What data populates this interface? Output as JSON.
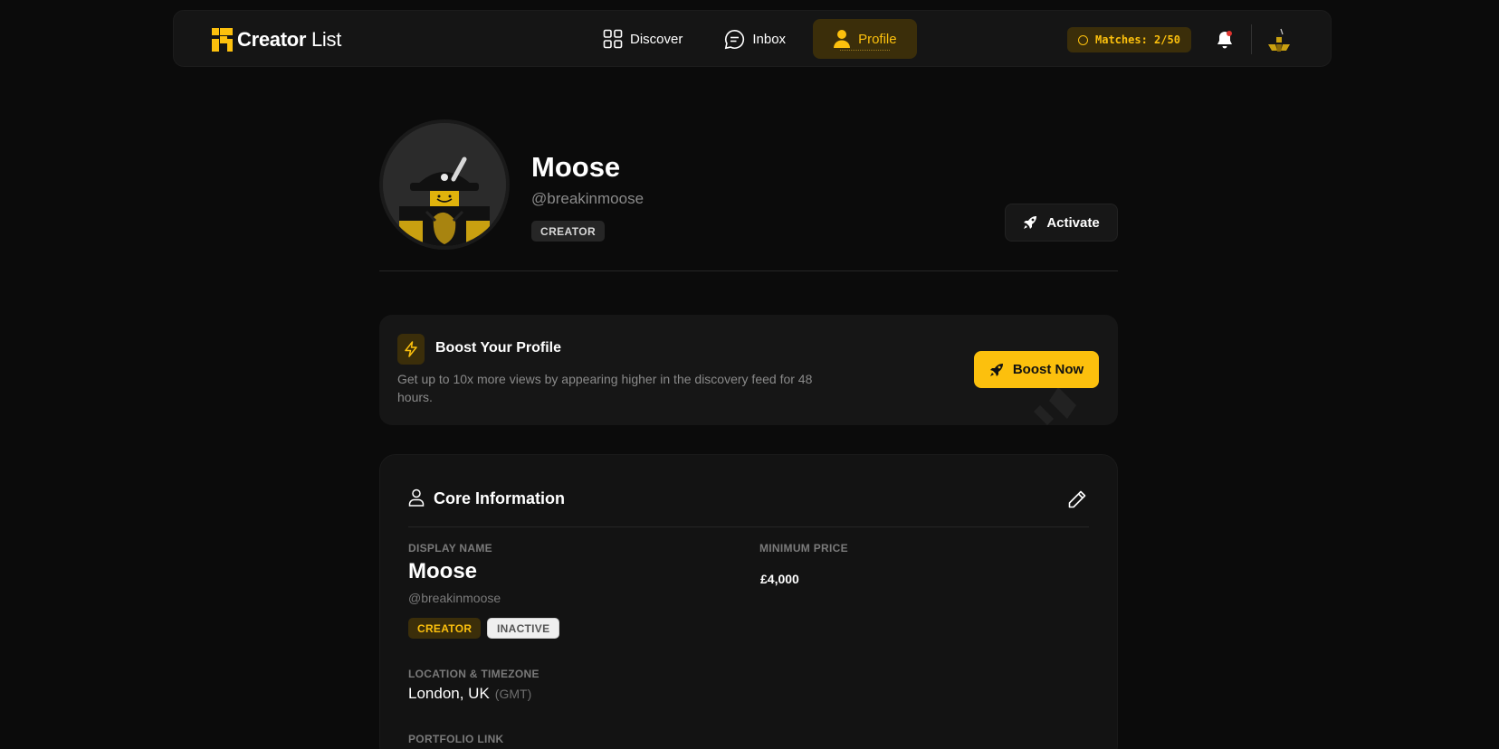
{
  "brand": {
    "name_bold": "Creator",
    "name_light": " List",
    "accent": "#fcc00d"
  },
  "nav": {
    "items": [
      {
        "label": "Discover",
        "icon": "grid-icon"
      },
      {
        "label": "Inbox",
        "icon": "chat-icon"
      },
      {
        "label": "Profile",
        "icon": "user-icon",
        "active": true
      }
    ],
    "matches": "Matches: 2/50"
  },
  "profile": {
    "name": "Moose",
    "handle": "@breakinmoose",
    "role_badge": "CREATOR",
    "activate_label": "Activate"
  },
  "boost": {
    "title": "Boost Your Profile",
    "description": "Get up to 10x more views by appearing higher in the discovery feed for 48 hours.",
    "button_label": "Boost Now"
  },
  "core": {
    "title": "Core Information",
    "display_name_label": "DISPLAY NAME",
    "display_name": "Moose",
    "handle": "@breakinmoose",
    "badge_creator": "CREATOR",
    "badge_inactive": "INACTIVE",
    "location_label": "LOCATION & TIMEZONE",
    "location": "London, UK",
    "timezone": "(GMT)",
    "portfolio_label": "PORTFOLIO LINK",
    "min_price_label": "MINIMUM PRICE",
    "min_price": "£4,000"
  }
}
